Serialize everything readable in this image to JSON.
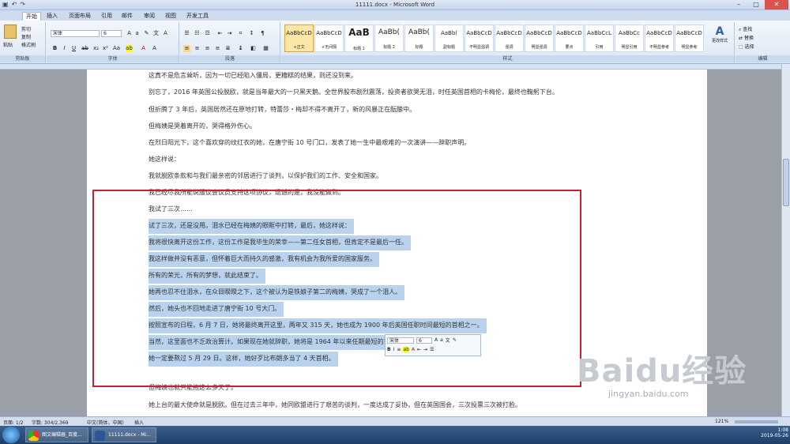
{
  "window": {
    "title": "11111.docx - Microsoft Word",
    "qa_icons": [
      "save-icon",
      "undo-icon",
      "redo-icon"
    ]
  },
  "tabs": [
    "开始",
    "插入",
    "页面布局",
    "引用",
    "邮件",
    "审阅",
    "视图",
    "开发工具"
  ],
  "ribbon": {
    "clipboard": {
      "paste": "粘贴",
      "cut": "剪切",
      "copy": "复制",
      "format_painter": "格式刷",
      "group": "剪贴板"
    },
    "font": {
      "name": "宋体",
      "size": "6",
      "group": "字体"
    },
    "paragraph": {
      "group": "段落"
    },
    "styles": {
      "group": "样式",
      "change": "更改样式",
      "items": [
        {
          "sample": "AaBbCcD",
          "name": "+正文"
        },
        {
          "sample": "AaBbCcD",
          "name": "+无间隔"
        },
        {
          "sample": "AaB",
          "name": "标题 1"
        },
        {
          "sample": "AaBb(",
          "name": "标题 2"
        },
        {
          "sample": "AaBb(",
          "name": "标题"
        },
        {
          "sample": "AaBb(",
          "name": "副标题"
        },
        {
          "sample": "AaBbCcD",
          "name": "不明显强调"
        },
        {
          "sample": "AaBbCcD",
          "name": "强调"
        },
        {
          "sample": "AaBbCcD",
          "name": "明显强调"
        },
        {
          "sample": "AaBbCcD",
          "name": "要点"
        },
        {
          "sample": "AaBbCcL",
          "name": "引用"
        },
        {
          "sample": "AaBbCc",
          "name": "明显引用"
        },
        {
          "sample": "AaBbCcD",
          "name": "不明显参考"
        },
        {
          "sample": "AaBbCcD",
          "name": "明显参考"
        }
      ]
    },
    "editing": {
      "find": "查找",
      "replace": "替换",
      "select": "选择",
      "group": "编辑"
    }
  },
  "document": {
    "lines": [
      "这真不是危言耸听，因为一切已经陷入僵局，更糟糕的结果，则还没到来。",
      "别忘了，2016 年英国公投脱欧，就是当年最大的一只黑天鹅。全世界股市剧烈震荡，投资者欲哭无泪，时任英国首相的卡梅伦，最终也鞠躬下台。",
      "但折腾了 3 年后，英国居然还在原地打转，特蕾莎・梅却不得不离开了，新的风暴正在酝酿中。",
      "但梅姨是哭着离开的，哭得格外伤心。",
      "在烈日阳光下，这个喜欢穿的纹红衣的她，在唐宁街 10 号门口，发表了她一生中最艰难的一次演讲——辞职声明。",
      "她这样说：",
      "我就脱欧条款和与我们最亲密的邻居进行了谈判，以保护我们的工作、安全和国家。",
      "我已经尽我所能说服议会议员支持这项协议，遗憾的是，我没能做到。",
      "我试了三次……",
      "试了三次，还是没用。泪水已经在梅姨的眼眶中打转，最后，她这样说：",
      "我将很快离开这份工作，这份工作是我毕生的荣幸——第二任女首相，但肯定不是最后一任。",
      "我这样做并没有恶意，但怀着巨大而持久的感激，我有机会为我所爱的国家服务。",
      "所有的荣光，所有的梦想，就此结束了。",
      "她再也忍不住泪水，在众目睽睽之下，这个被认为是铁娘子第二的梅姨，哭成了一个泪人。",
      "然后，她头也不回地走进了唐宁街 10 号大门。",
      "按照宣布的日程，6 月 7 日，她将最终离开这里，两年又 315 天，她也成为 1900 年后英国任职时间最短的首相之一。",
      "当然，这里面也不乏政治算计。如果现在她就辞职，她将是 1964 年以来任期最短的首相。",
      "她一定要熬过 5 月 29 日。这样，她好歹比布朗多当了 4 天首相。",
      "但梅姨也就只能拖这么多天了。",
      "她上台的最大使命就是脱欧。但在过去三年中，她同欧盟进行了艰苦的谈判，一度达成了妥协，但在英国国会，三次投票三次被打脸。"
    ]
  },
  "mini_toolbar": {
    "font": "宋体",
    "size": "6"
  },
  "status": {
    "page": "页面: 1/2",
    "words": "字数: 304/2,369",
    "language": "中文(简体，中国)",
    "mode": "插入",
    "zoom": "121%"
  },
  "taskbar": {
    "tasks": [
      {
        "label": "图文编辑器_百度...",
        "icon": "chrome-icon"
      },
      {
        "label": "11111.docx - Mi...",
        "icon": "word-icon"
      }
    ],
    "time": "1:08",
    "date": "2019-05-26"
  },
  "watermark": {
    "brand": "Baidu经验",
    "url": "jingyan.baidu.com"
  },
  "colors": {
    "selection": "#b9d3ee",
    "annotation": "#c8202c"
  }
}
